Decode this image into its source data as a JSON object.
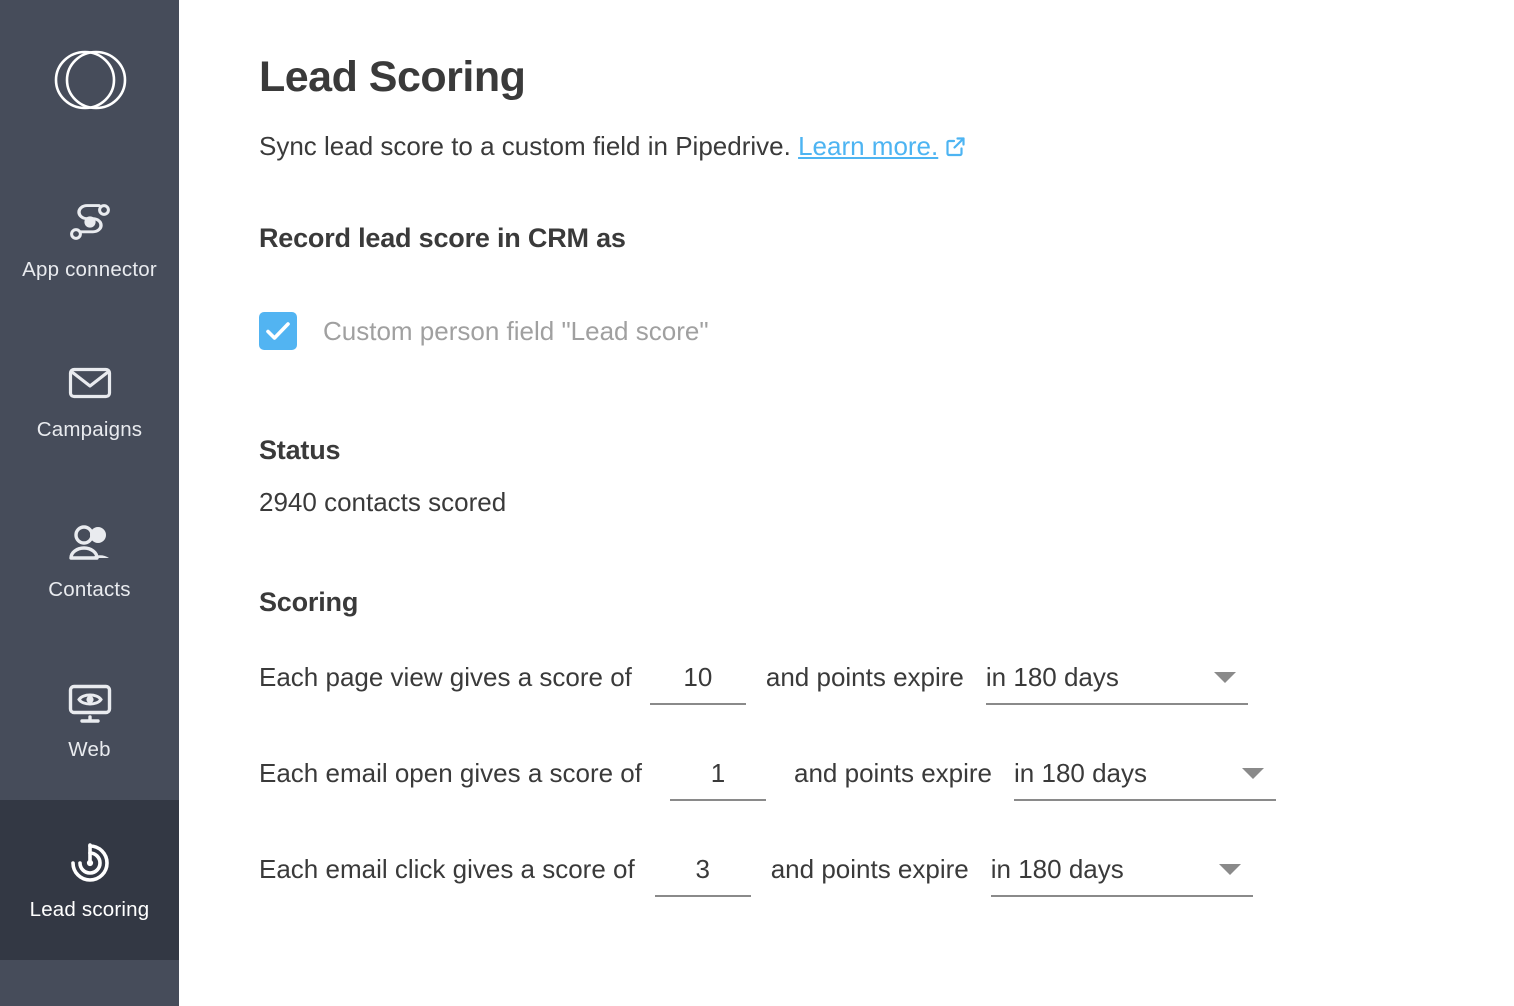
{
  "sidebar": {
    "logo_name": "outfunnel-logo",
    "background_color": "#464c5a",
    "active_background_color": "#333844",
    "items": [
      {
        "label": "App connector",
        "icon": "app-connector-icon",
        "active": false
      },
      {
        "label": "Campaigns",
        "icon": "envelope-icon",
        "active": false
      },
      {
        "label": "Contacts",
        "icon": "people-icon",
        "active": false
      },
      {
        "label": "Web",
        "icon": "monitor-eye-icon",
        "active": false
      },
      {
        "label": "Lead scoring",
        "icon": "target-power-icon",
        "active": true
      }
    ]
  },
  "header": {
    "title": "Lead Scoring",
    "subtitle_text": "Sync lead score to a custom field in Pipedrive.",
    "link_label": "Learn more.",
    "link_color": "#4db4f2",
    "external_icon": "external-link-icon"
  },
  "record_section": {
    "heading": "Record lead score in CRM as",
    "checkbox": {
      "label": "Custom person field \"Lead score\"",
      "checked": true,
      "color": "#52b4f2"
    }
  },
  "status_section": {
    "heading": "Status",
    "value": "2940 contacts scored"
  },
  "scoring_section": {
    "heading": "Scoring",
    "rows": [
      {
        "label": "Each page view gives a score of",
        "score": "10",
        "mid_label": "and points expire",
        "expiry": "in 180 days",
        "caret_icon": "chevron-down-icon"
      },
      {
        "label": "Each email open gives a score of",
        "score": "1",
        "mid_label": "and points expire",
        "expiry": "in 180 days",
        "caret_icon": "chevron-down-icon"
      },
      {
        "label": "Each email click gives a score of",
        "score": "3",
        "mid_label": "and points expire",
        "expiry": "in 180 days",
        "caret_icon": "chevron-down-icon"
      }
    ]
  }
}
